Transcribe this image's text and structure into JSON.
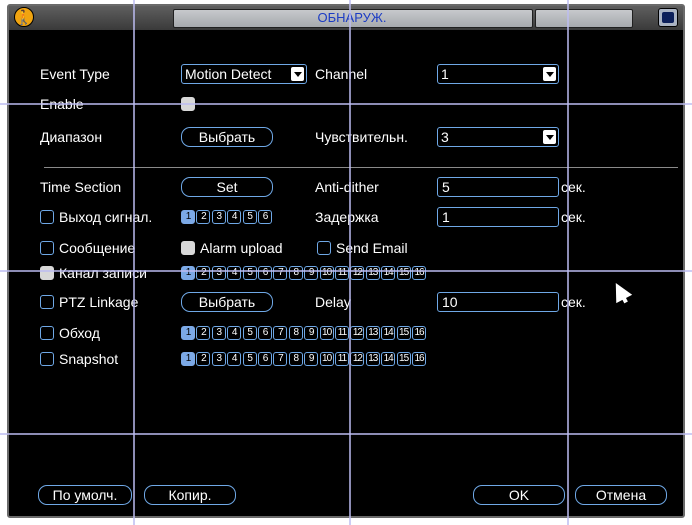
{
  "window": {
    "title": "ОБНАРУЖ."
  },
  "form": {
    "event_type": {
      "label": "Event Type",
      "value": "Motion Detect"
    },
    "channel": {
      "label": "Channel",
      "value": "1"
    },
    "enable": {
      "label": "Enable",
      "checked": true
    },
    "range": {
      "label": "Диапазон",
      "button": "Выбрать"
    },
    "sensitivity": {
      "label": "Чувствительн.",
      "value": "3"
    },
    "time_section": {
      "label": "Time Section",
      "button": "Set"
    },
    "anti_dither": {
      "label": "Anti-dither",
      "value": "5",
      "unit": "сек."
    },
    "alarm_out": {
      "label": "Выход сигнал.",
      "checked": false,
      "numbers": [
        "1",
        "2",
        "3",
        "4",
        "5",
        "6"
      ],
      "selected": [
        1
      ]
    },
    "delay_ru": {
      "label": "Задержка",
      "value": "1",
      "unit": "сек."
    },
    "message": {
      "label": "Сообщение",
      "checked": false
    },
    "alarm_upload": {
      "label": "Alarm upload",
      "checked": true
    },
    "send_email": {
      "label": "Send Email",
      "checked": false
    },
    "record_channel": {
      "label": "Канал записи",
      "checked": true,
      "numbers": [
        "1",
        "2",
        "3",
        "4",
        "5",
        "6",
        "7",
        "8",
        "9",
        "10",
        "11",
        "12",
        "13",
        "14",
        "15",
        "16"
      ],
      "selected": [
        1
      ]
    },
    "ptz_linkage": {
      "label": "PTZ Linkage",
      "checked": false,
      "button": "Выбрать"
    },
    "delay_en": {
      "label": "Delay",
      "value": "10",
      "unit": "сек."
    },
    "tour": {
      "label": "Обход",
      "checked": false,
      "numbers": [
        "1",
        "2",
        "3",
        "4",
        "5",
        "6",
        "7",
        "8",
        "9",
        "10",
        "11",
        "12",
        "13",
        "14",
        "15",
        "16"
      ],
      "selected": [
        1
      ]
    },
    "snapshot": {
      "label": "Snapshot",
      "checked": false,
      "numbers": [
        "1",
        "2",
        "3",
        "4",
        "5",
        "6",
        "7",
        "8",
        "9",
        "10",
        "11",
        "12",
        "13",
        "14",
        "15",
        "16"
      ],
      "selected": [
        1
      ]
    }
  },
  "footer": {
    "default": "По умолч.",
    "copy": "Копир.",
    "ok": "OK",
    "cancel": "Отмена"
  },
  "colors": {
    "accent": "#6fa8e6",
    "title_text": "#1c3cc4",
    "background": "#000000",
    "logo": "#f0a411"
  },
  "icons": {
    "logo": "walking-person-icon",
    "close": "close-icon",
    "dropdown": "chevron-down-icon",
    "cursor": "mouse-pointer-icon"
  }
}
